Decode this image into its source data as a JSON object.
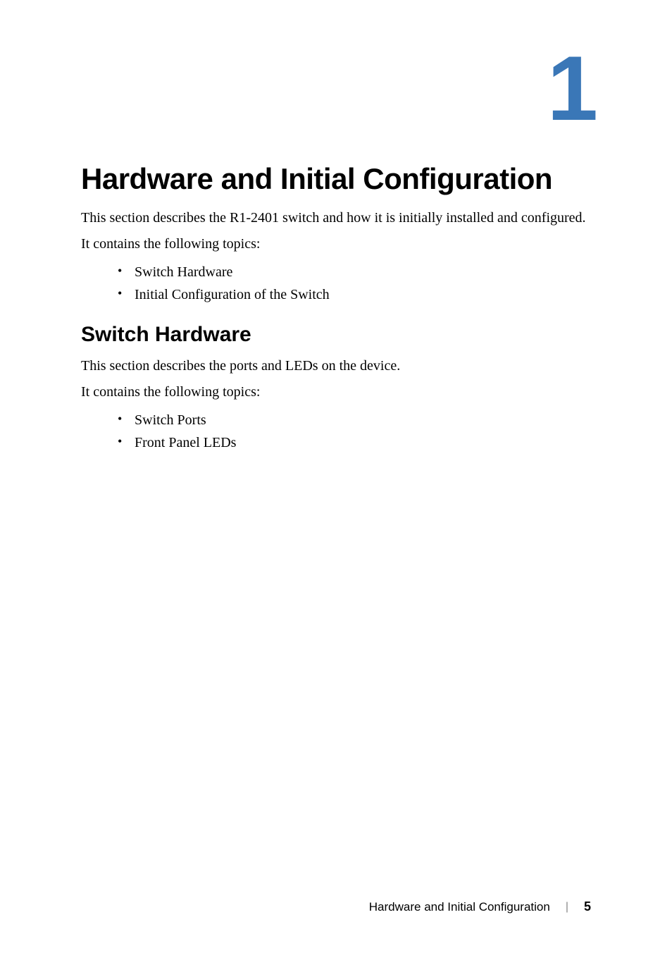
{
  "chapter": {
    "number": "1",
    "title": "Hardware and Initial Configuration"
  },
  "intro": {
    "p1": "This section describes the R1-2401 switch and how it is initially installed and configured.",
    "p2": "It contains the following topics:",
    "bullets": [
      "Switch Hardware",
      "Initial Configuration of the Switch"
    ]
  },
  "section1": {
    "heading": "Switch Hardware",
    "p1": "This section describes the ports and LEDs on the device.",
    "p2": "It contains the following topics:",
    "bullets": [
      "Switch Ports",
      "Front Panel LEDs"
    ]
  },
  "footer": {
    "title": "Hardware and Initial Configuration",
    "page": "5"
  }
}
